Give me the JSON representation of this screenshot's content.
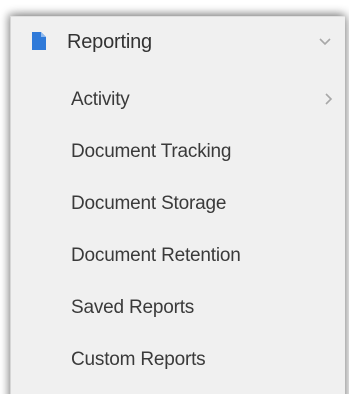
{
  "menu": {
    "header": {
      "label": "Reporting",
      "icon": "document-icon",
      "expanded": true,
      "icon_color": "#2f7ad9"
    },
    "items": [
      {
        "label": "Activity",
        "has_submenu": true
      },
      {
        "label": "Document Tracking",
        "has_submenu": false
      },
      {
        "label": "Document Storage",
        "has_submenu": false
      },
      {
        "label": "Document Retention",
        "has_submenu": false
      },
      {
        "label": "Saved Reports",
        "has_submenu": false
      },
      {
        "label": "Custom Reports",
        "has_submenu": false
      }
    ]
  }
}
